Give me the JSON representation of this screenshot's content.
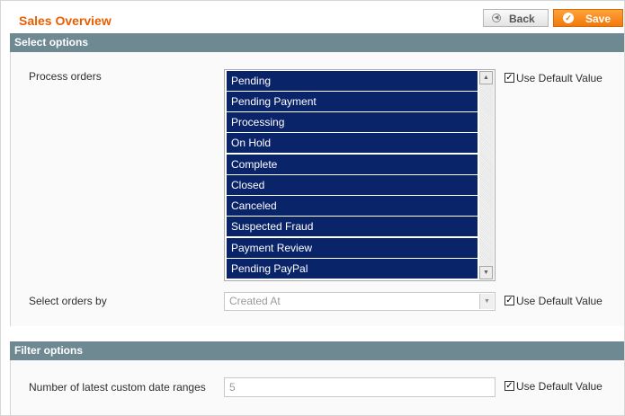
{
  "header": {
    "title": "Sales Overview",
    "back_label": "Back",
    "save_label": "Save"
  },
  "select_options": {
    "heading": "Select options",
    "process_orders": {
      "label": "Process orders",
      "options": [
        "Pending",
        "Pending Payment",
        "Processing",
        "On Hold",
        "Complete",
        "Closed",
        "Canceled",
        "Suspected Fraud",
        "Payment Review",
        "Pending PayPal"
      ],
      "use_default_label": "Use Default Value"
    },
    "select_orders_by": {
      "label": "Select orders by",
      "value": "Created At",
      "use_default_label": "Use Default Value"
    }
  },
  "filter_options": {
    "heading": "Filter options",
    "custom_date_ranges": {
      "label": "Number of latest custom date ranges",
      "value": "5",
      "use_default_label": "Use Default Value"
    }
  },
  "colors": {
    "accent": "#eb5e00",
    "section_header": "#6f8992",
    "selected_option": "#0a246a",
    "save_button": "#f2780a"
  }
}
